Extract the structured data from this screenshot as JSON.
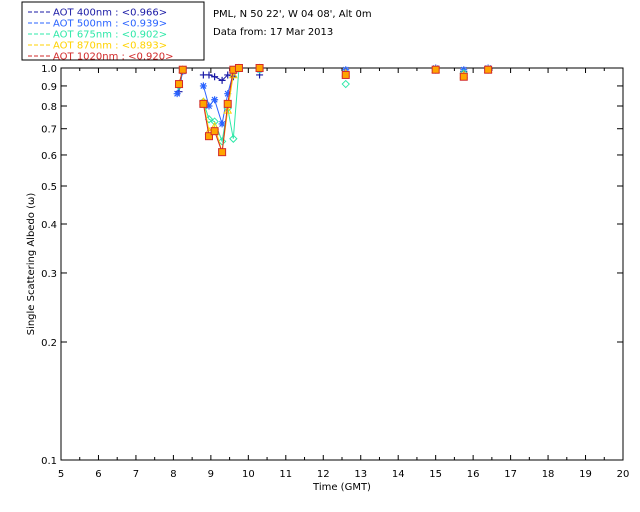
{
  "chart_data": {
    "type": "scatter",
    "header": {
      "location": "PML, N 50 22', W 04 08', Alt 0m",
      "date": "Data from: 17 Mar 2013"
    },
    "xlabel": "Time (GMT)",
    "ylabel": "Single Scattering Albedo (ω)",
    "xlim": [
      5,
      20
    ],
    "ylim": [
      0.1,
      1.0
    ],
    "yscale": "log",
    "xticks": [
      5,
      6,
      7,
      8,
      9,
      10,
      11,
      12,
      13,
      14,
      15,
      16,
      17,
      18,
      19,
      20
    ],
    "xtick_labels": [
      "5",
      "6",
      "7",
      "8",
      "9",
      "10",
      "11",
      "12",
      "13",
      "14",
      "15",
      "16",
      "17",
      "18",
      "19",
      "20"
    ],
    "yticks": [
      0.1,
      0.2,
      0.3,
      0.4,
      0.5,
      0.6,
      0.7,
      0.8,
      0.9,
      1.0
    ],
    "ytick_labels": [
      "0.1",
      "0.2",
      "0.3",
      "0.4",
      "0.5",
      "0.6",
      "0.7",
      "0.8",
      "0.9",
      "1.0"
    ],
    "grid": false,
    "legend_position": "top-left",
    "series": [
      {
        "name": "AOT  400nm : <0.966>",
        "color": "#1a1aa6",
        "marker": "plus",
        "connected": [
          [
            [
              8.15,
              0.87
            ],
            [
              8.25,
              0.99
            ]
          ],
          [
            [
              8.8,
              0.96
            ],
            [
              8.95,
              0.96
            ],
            [
              9.1,
              0.95
            ],
            [
              9.3,
              0.93
            ],
            [
              9.45,
              0.96
            ],
            [
              9.6,
              0.95
            ],
            [
              9.75,
              1.0
            ]
          ]
        ],
        "points": [
          [
            10.3,
            0.96
          ],
          [
            12.6,
            0.98
          ],
          [
            15.0,
            0.99
          ],
          [
            15.75,
            0.98
          ],
          [
            16.4,
            0.99
          ]
        ]
      },
      {
        "name": "AOT  500nm : <0.939>",
        "color": "#2a63ff",
        "marker": "asterisk",
        "connected": [
          [
            [
              8.1,
              0.86
            ],
            [
              8.25,
              0.98
            ]
          ],
          [
            [
              8.8,
              0.9
            ],
            [
              8.95,
              0.8
            ],
            [
              9.1,
              0.83
            ],
            [
              9.3,
              0.72
            ],
            [
              9.45,
              0.86
            ],
            [
              9.6,
              0.97
            ],
            [
              9.75,
              1.0
            ]
          ]
        ],
        "points": [
          [
            10.3,
            0.99
          ],
          [
            12.6,
            0.99
          ],
          [
            15.0,
            1.0
          ],
          [
            15.75,
            0.99
          ],
          [
            16.4,
            1.0
          ]
        ]
      },
      {
        "name": "AOT  675nm : <0.902>",
        "color": "#2ee8a8",
        "marker": "diamond",
        "connected": [
          [
            [
              8.15,
              0.9
            ],
            [
              8.25,
              0.99
            ]
          ],
          [
            [
              8.8,
              0.82
            ],
            [
              8.95,
              0.74
            ],
            [
              9.1,
              0.73
            ],
            [
              9.3,
              0.65
            ],
            [
              9.45,
              0.79
            ],
            [
              9.6,
              0.66
            ],
            [
              9.75,
              1.0
            ]
          ]
        ],
        "points": [
          [
            10.3,
            0.99
          ],
          [
            12.6,
            0.91
          ],
          [
            15.0,
            0.99
          ],
          [
            15.75,
            0.97
          ],
          [
            16.4,
            0.99
          ]
        ]
      },
      {
        "name": "AOT  870nm : <0.893>",
        "color": "#ffd200",
        "marker": "triangle",
        "connected": [
          [
            [
              8.15,
              0.91
            ],
            [
              8.25,
              0.99
            ]
          ],
          [
            [
              8.8,
              0.82
            ],
            [
              8.95,
              0.69
            ],
            [
              9.1,
              0.71
            ],
            [
              9.3,
              0.61
            ],
            [
              9.45,
              0.78
            ],
            [
              9.6,
              0.96
            ],
            [
              9.75,
              1.0
            ]
          ]
        ],
        "points": [
          [
            10.3,
            1.0
          ],
          [
            12.6,
            0.97
          ],
          [
            15.0,
            0.99
          ],
          [
            15.75,
            0.96
          ],
          [
            16.4,
            0.99
          ]
        ]
      },
      {
        "name": "AOT 1020nm : <0.920>",
        "color": "#d22a2a",
        "marker": "square",
        "connected": [
          [
            [
              8.15,
              0.91
            ],
            [
              8.25,
              0.99
            ]
          ],
          [
            [
              8.8,
              0.81
            ],
            [
              8.95,
              0.67
            ],
            [
              9.1,
              0.69
            ],
            [
              9.3,
              0.61
            ],
            [
              9.45,
              0.81
            ],
            [
              9.6,
              0.99
            ],
            [
              9.75,
              1.0
            ]
          ]
        ],
        "points": [
          [
            10.3,
            1.0
          ],
          [
            12.6,
            0.96
          ],
          [
            15.0,
            0.99
          ],
          [
            15.75,
            0.95
          ],
          [
            16.4,
            0.99
          ]
        ]
      }
    ]
  },
  "colors": {
    "marker_fill": "#ffa500",
    "axis": "#000000",
    "legend_border": "#000000"
  }
}
